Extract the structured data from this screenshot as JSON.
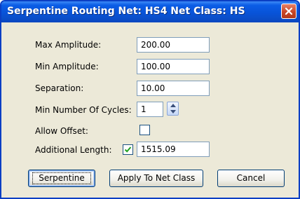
{
  "window": {
    "title": "Serpentine Routing Net: HS4 Net Class: HS"
  },
  "form": {
    "max_amplitude": {
      "label": "Max Amplitude:",
      "value": "200.00"
    },
    "min_amplitude": {
      "label": "Min Amplitude:",
      "value": "100.00"
    },
    "separation": {
      "label": "Separation:",
      "value": "10.00"
    },
    "min_cycles": {
      "label": "Min Number Of Cycles:",
      "value": "1"
    },
    "allow_offset": {
      "label": "Allow Offset:",
      "checked": false
    },
    "additional_length": {
      "label": "Additional Length:",
      "checked": true,
      "value": "1515.09"
    }
  },
  "buttons": {
    "serpentine": "Serpentine",
    "apply": "Apply To Net Class",
    "cancel": "Cancel"
  },
  "colors": {
    "title_bar": "#0a53d8",
    "dialog_bg": "#ece9d8",
    "close_button": "#c84626",
    "check_mark": "#21a121"
  },
  "icons": {
    "close": "close-icon",
    "check": "check-icon",
    "spin_up": "spin-up-icon",
    "spin_down": "spin-down-icon"
  }
}
